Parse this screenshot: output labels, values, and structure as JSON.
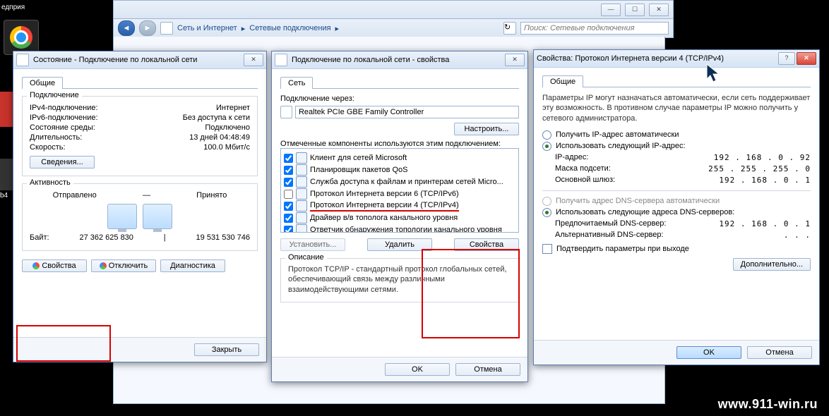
{
  "desktop": {
    "truncated_label": "едприя"
  },
  "explorer": {
    "crumbs": [
      "Сеть и Интернет",
      "Сетевые подключения"
    ],
    "search_placeholder": "Поиск: Сетевые подключения"
  },
  "status_window": {
    "title": "Состояние - Подключение по локальной сети",
    "tab_general": "Общие",
    "group_connection": "Подключение",
    "rows": [
      {
        "k": "IPv4-подключение:",
        "v": "Интернет"
      },
      {
        "k": "IPv6-подключение:",
        "v": "Без доступа к сети"
      },
      {
        "k": "Состояние среды:",
        "v": "Подключено"
      },
      {
        "k": "Длительность:",
        "v": "13 дней 04:48:49"
      },
      {
        "k": "Скорость:",
        "v": "100.0 Мбит/с"
      }
    ],
    "btn_details": "Сведения...",
    "group_activity": "Активность",
    "activity_sent_label": "Отправлено",
    "activity_recv_label": "Принято",
    "bytes_label": "Байт:",
    "bytes_sent": "27 362 625 830",
    "bytes_recv": "19 531 530 746",
    "btn_properties": "Свойства",
    "btn_disable": "Отключить",
    "btn_diagnose": "Диагностика",
    "btn_close": "Закрыть"
  },
  "props_window": {
    "title": "Подключение по локальной сети - свойства",
    "tab_network": "Сеть",
    "connect_through": "Подключение через:",
    "adapter": "Realtek PCIe GBE Family Controller",
    "btn_configure": "Настроить...",
    "components_label": "Отмеченные компоненты используются этим подключением:",
    "components": [
      {
        "checked": true,
        "label": "Клиент для сетей Microsoft"
      },
      {
        "checked": true,
        "label": "Планировщик пакетов QoS"
      },
      {
        "checked": true,
        "label": "Служба доступа к файлам и принтерам сетей Micro..."
      },
      {
        "checked": false,
        "label": "Протокол Интернета версии 6 (TCP/IPv6)"
      },
      {
        "checked": true,
        "label": "Протокол Интернета версии 4 (TCP/IPv4)",
        "highlight": true
      },
      {
        "checked": true,
        "label": "Драйвер в/в тополога канального уровня"
      },
      {
        "checked": true,
        "label": "Ответчик обнаружения топологии канального уровня"
      }
    ],
    "btn_install": "Установить...",
    "btn_uninstall": "Удалить",
    "btn_props": "Свойства",
    "desc_label": "Описание",
    "desc_text": "Протокол TCP/IP - стандартный протокол глобальных сетей, обеспечивающий связь между различными взаимодействующими сетями.",
    "btn_ok": "OK",
    "btn_cancel": "Отмена"
  },
  "ipv4_window": {
    "title": "Свойства: Протокол Интернета версии 4 (TCP/IPv4)",
    "tab_general": "Общие",
    "intro": "Параметры IP могут назначаться автоматически, если сеть поддерживает эту возможность. В противном случае параметры IP можно получить у сетевого администратора.",
    "radio_auto_ip": "Получить IP-адрес автоматически",
    "radio_manual_ip": "Использовать следующий IP-адрес:",
    "ip_label": "IP-адрес:",
    "ip_value": "192 . 168 .  0  .  92",
    "mask_label": "Маска подсети:",
    "mask_value": "255 . 255 . 255 .  0",
    "gw_label": "Основной шлюз:",
    "gw_value": "192 . 168 .  0  .  1",
    "radio_auto_dns": "Получить адрес DNS-сервера автоматически",
    "radio_manual_dns": "Использовать следующие адреса DNS-серверов:",
    "dns1_label": "Предпочитаемый DNS-сервер:",
    "dns1_value": "192 . 168 .  0  .  1",
    "dns2_label": "Альтернативный DNS-сервер:",
    "dns2_value": "  .     .     .   ",
    "confirm_label": "Подтвердить параметры при выходе",
    "btn_advanced": "Дополнительно...",
    "btn_ok": "OK",
    "btn_cancel": "Отмена"
  },
  "watermark": "www.911-win.ru"
}
